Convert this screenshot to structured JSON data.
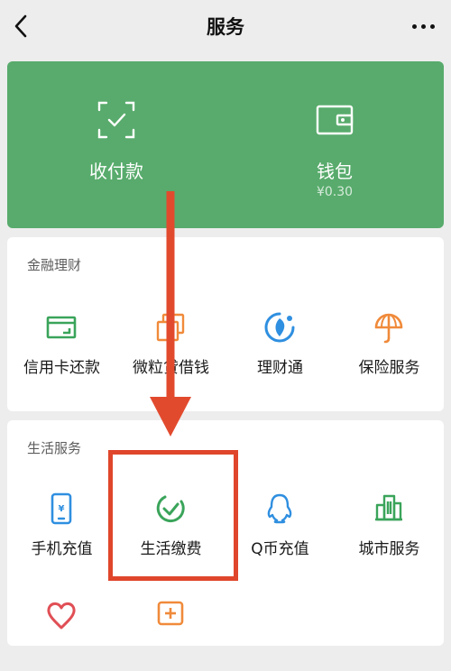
{
  "nav": {
    "title": "服务"
  },
  "pay": {
    "left_label": "收付款",
    "right_label": "钱包",
    "balance": "¥0.30",
    "color": "#58ab6c"
  },
  "finance": {
    "title": "金融理财",
    "items": [
      {
        "label": "信用卡还款",
        "icon": "credit-card-icon"
      },
      {
        "label": "微粒贷借钱",
        "icon": "loan-icon"
      },
      {
        "label": "理财通",
        "icon": "wealth-icon"
      },
      {
        "label": "保险服务",
        "icon": "insurance-icon"
      }
    ]
  },
  "life": {
    "title": "生活服务",
    "items": [
      {
        "label": "手机充值",
        "icon": "phone-recharge-icon"
      },
      {
        "label": "生活缴费",
        "icon": "utility-pay-icon"
      },
      {
        "label": "Q币充值",
        "icon": "qq-coin-icon"
      },
      {
        "label": "城市服务",
        "icon": "city-service-icon"
      }
    ],
    "more_icons": [
      "charity-icon",
      "health-icon"
    ]
  },
  "annotation": {
    "color": "#e0462b",
    "arrow_color": "#e24a2e"
  }
}
